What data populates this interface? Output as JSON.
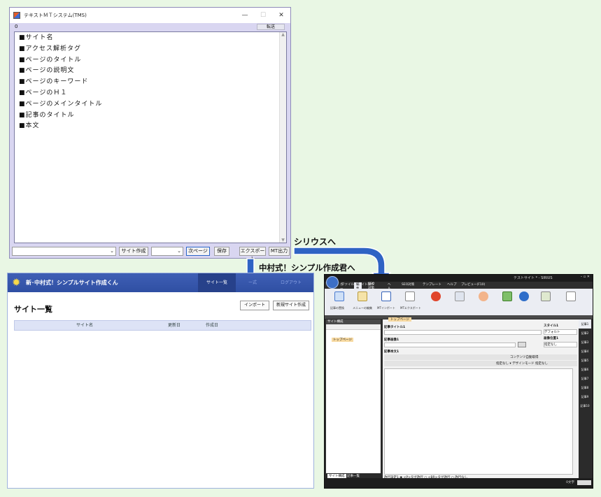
{
  "tms": {
    "title": "テキストＭＴシステム(TMS)",
    "counter": "0",
    "send_label": "転送",
    "lines": [
      "■サイト名",
      "■アクセス解析タグ",
      "■ページのタイトル",
      "■ページの説明文",
      "■ページのキーワード",
      "■ページのＨ１",
      "■ページのメインタイトル",
      "■記事のタイトル",
      "■本文"
    ],
    "buttons": {
      "create_site": "サイト作成",
      "next_page": "次ページ",
      "save": "保存",
      "export": "エクスポート",
      "mt_output": "MT出力"
    }
  },
  "callouts": {
    "to_sirius": "シリウスへ",
    "to_simple": "中村式！シンプル作成君へ"
  },
  "simple": {
    "app_name": "新･中村式！シンプルサイト作成くん",
    "nav": {
      "site_list": "サイト一覧",
      "hidden": "ー式",
      "logout": "ログアウト"
    },
    "page_title": "サイト一覧",
    "import_label": "インポート",
    "new_site_label": "新規サイト作成",
    "columns": [
      "サイト名",
      "更新日",
      "作成日"
    ]
  },
  "sirius": {
    "title": "テストサイト * - SIRIUS",
    "menus": [
      "ファイル",
      "サイト操作",
      "",
      "SEO対策",
      "テンプレート",
      "ヘルプ",
      "プレビュー(F10)"
    ],
    "tabs": [
      "ホーム",
      "編集",
      "SEO対策",
      "ヘルプ"
    ],
    "ribbon": [
      "記事の置換",
      "メニューの編集",
      "MTインポート",
      "MTエクスポート"
    ],
    "left_title": "サイト構成",
    "tree_item": "トップページ",
    "left_tabs": [
      "サイト構成",
      "記事一覧"
    ],
    "edit_tab": "トップページ",
    "label_title": "記事タイトル1",
    "label_image": "記事画像1",
    "label_body": "記事本文1",
    "label_style": "スタイル1",
    "style_value": "デフォルト",
    "label_imgpos": "画像位置1",
    "imgpos_value": "指定なし",
    "toolbar_text": "コンテンツ自動取得",
    "toolbar_text2": "指定なし ▾  デザインモード  指定なし",
    "linebreak": "改行設定1  ◉ <P>タグ改行  ○ <BR>タグ改行  ○ 改行なし",
    "right_tabs": [
      "記事1",
      "記事2",
      "記事3",
      "記事4",
      "記事5",
      "記事6",
      "記事7",
      "記事8",
      "記事9",
      "記事10"
    ],
    "status": "0文字"
  }
}
